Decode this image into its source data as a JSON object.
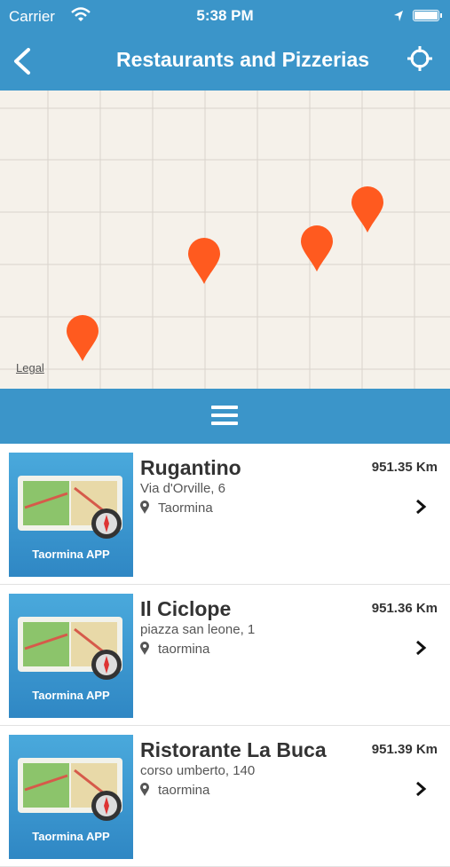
{
  "status_bar": {
    "carrier": "Carrier",
    "time": "5:38 PM"
  },
  "header": {
    "title": "Restaurants and Pizzerias"
  },
  "map": {
    "legal_label": "Legal"
  },
  "list": {
    "thumbnail_label": "Taormina APP",
    "items": [
      {
        "name": "Rugantino",
        "address": "Via d'Orville, 6",
        "city": "Taormina",
        "distance": "951.35 Km"
      },
      {
        "name": "Il Ciclope",
        "address": "piazza san leone, 1",
        "city": "taormina",
        "distance": "951.36 Km"
      },
      {
        "name": "Ristorante La Buca",
        "address": "corso umberto, 140",
        "city": "taormina",
        "distance": "951.39 Km"
      }
    ]
  },
  "colors": {
    "header_blue": "#3b95c9",
    "marker_orange": "#ff5a1f",
    "map_background": "#f5f1ea"
  },
  "icons": [
    "wifi-icon",
    "location-arrow-icon",
    "battery-icon",
    "back-chevron-icon",
    "crosshair-icon",
    "map-pin-icon",
    "hamburger-menu-icon",
    "location-pin-icon",
    "chevron-right-icon"
  ]
}
